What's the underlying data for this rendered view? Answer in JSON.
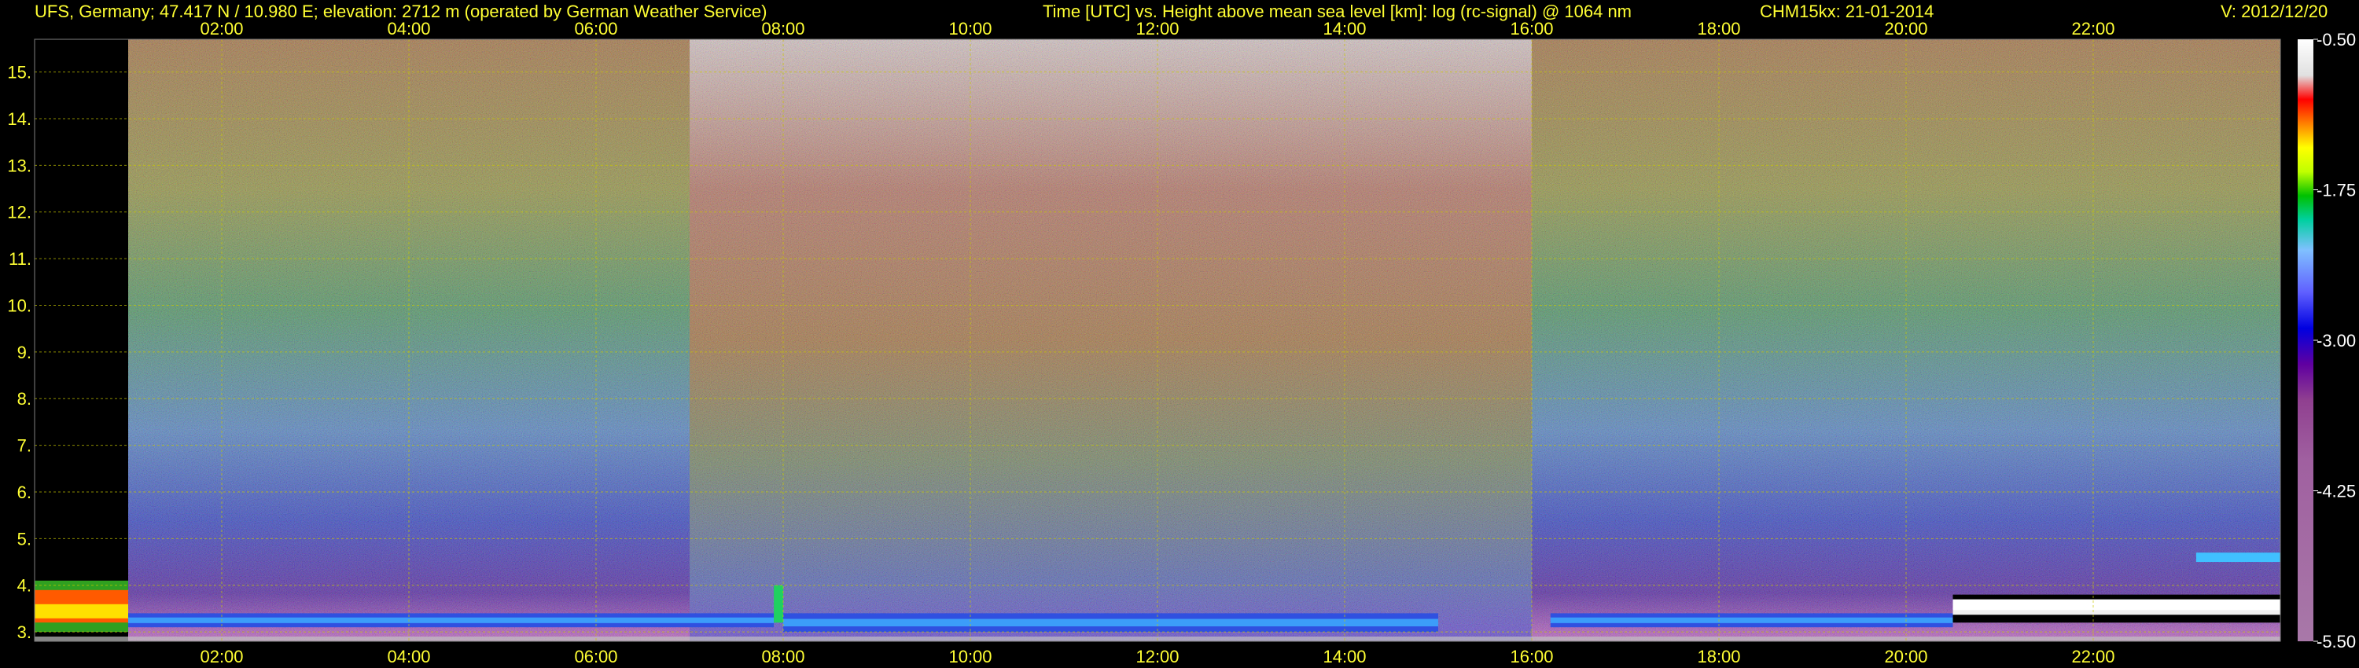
{
  "header": {
    "station": "UFS, Germany; 47.417 N / 10.980 E; elevation: 2712 m  (operated by German Weather Service)",
    "axes_title": "Time [UTC] vs. Height above mean sea level [km]: log (rc-signal) @ 1064 nm",
    "instrument_date": "CHM15kx: 21-01-2014",
    "version": "V: 2012/12/20"
  },
  "colors": {
    "text": "#ffff33",
    "grid": "#c8c800",
    "background": "#000000"
  },
  "chart_data": {
    "type": "heatmap",
    "title": "Time [UTC] vs. Height above mean sea level [km]: log (rc-signal) @ 1064 nm",
    "xlabel": "Time [UTC]",
    "ylabel": "Height above mean sea level [km]",
    "x_range": [
      0,
      24
    ],
    "y_range": [
      2.8,
      15.7
    ],
    "x_ticks": [
      "02:00",
      "04:00",
      "06:00",
      "08:00",
      "10:00",
      "12:00",
      "14:00",
      "16:00",
      "18:00",
      "20:00",
      "22:00"
    ],
    "x_tick_values": [
      2,
      4,
      6,
      8,
      10,
      12,
      14,
      16,
      18,
      20,
      22
    ],
    "y_ticks": [
      "3.",
      "4.",
      "5.",
      "6.",
      "7.",
      "8.",
      "9.",
      "10.",
      "11.",
      "12.",
      "13.",
      "14.",
      "15."
    ],
    "y_tick_values": [
      3,
      4,
      5,
      6,
      7,
      8,
      9,
      10,
      11,
      12,
      13,
      14,
      15
    ],
    "grid": true,
    "colorbar": {
      "labels": [
        "-0.50",
        "-1.75",
        "-3.00",
        "-4.25",
        "-5.50"
      ],
      "values": [
        -0.5,
        -1.75,
        -3.0,
        -4.25,
        -5.5
      ]
    },
    "scenes": [
      {
        "name": "night",
        "x_range": [
          1,
          7
        ],
        "description_level": "low"
      },
      {
        "name": "daylight",
        "x_range": [
          7,
          16
        ],
        "description_level": "high"
      },
      {
        "name": "night",
        "x_range": [
          16,
          24
        ],
        "description_level": "low"
      }
    ],
    "features": [
      {
        "kind": "strong-return",
        "x_range": [
          0,
          1
        ],
        "y_range": [
          3.0,
          4.1
        ]
      },
      {
        "kind": "boundary-layer",
        "x_range": [
          1,
          7.9
        ],
        "y_range": [
          3.1,
          3.4
        ]
      },
      {
        "kind": "aerosol-plume",
        "x_range": [
          7.9,
          8.0
        ],
        "y_range": [
          3.2,
          4.0
        ]
      },
      {
        "kind": "boundary-layer",
        "x_range": [
          8.0,
          15.0
        ],
        "y_range": [
          3.0,
          3.4
        ]
      },
      {
        "kind": "boundary-layer",
        "x_range": [
          16.2,
          20.5
        ],
        "y_range": [
          3.1,
          3.4
        ]
      },
      {
        "kind": "cloud-layer",
        "x_range": [
          20.5,
          24
        ],
        "y_range": [
          3.2,
          3.8
        ]
      },
      {
        "kind": "cloud-patch",
        "x_range": [
          23.1,
          24
        ],
        "y_range": [
          4.5,
          4.7
        ]
      }
    ]
  }
}
